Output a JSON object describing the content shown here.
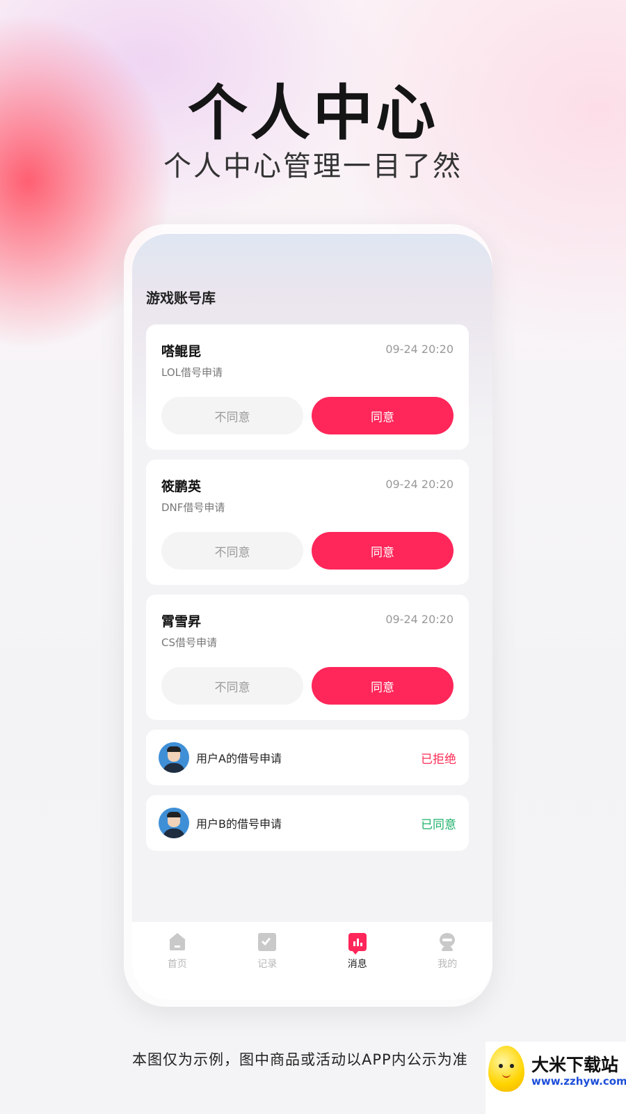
{
  "hero": {
    "title": "个人中心",
    "subtitle": "个人中心管理一目了然"
  },
  "app": {
    "header": "游戏账号库",
    "requests": [
      {
        "name": "嗒鲲昆",
        "time": "09-24 20:20",
        "desc": "LOL借号申请",
        "reject_label": "不同意",
        "accept_label": "同意"
      },
      {
        "name": "筱鹏英",
        "time": "09-24 20:20",
        "desc": "DNF借号申请",
        "reject_label": "不同意",
        "accept_label": "同意"
      },
      {
        "name": "霄雪昇",
        "time": "09-24 20:20",
        "desc": "CS借号申请",
        "reject_label": "不同意",
        "accept_label": "同意"
      }
    ],
    "history": [
      {
        "label": "用户A的借号申请",
        "status": "已拒绝",
        "status_color": "#ff2d55"
      },
      {
        "label": "用户B的借号申请",
        "status": "已同意",
        "status_color": "#1eb16a"
      }
    ],
    "tabbar": [
      {
        "label": "首页",
        "icon": "home-icon",
        "active": false
      },
      {
        "label": "记录",
        "icon": "check-icon",
        "active": false
      },
      {
        "label": "消息",
        "icon": "message-chart-icon",
        "active": true
      },
      {
        "label": "我的",
        "icon": "profile-icon",
        "active": false
      }
    ],
    "accent_color": "#ff2659"
  },
  "footer": {
    "disclaimer": "本图仅为示例，图中商品或活动以APP内公示为准"
  },
  "watermark": {
    "name": "大米下载站",
    "url": "www.zzhyw.com"
  }
}
